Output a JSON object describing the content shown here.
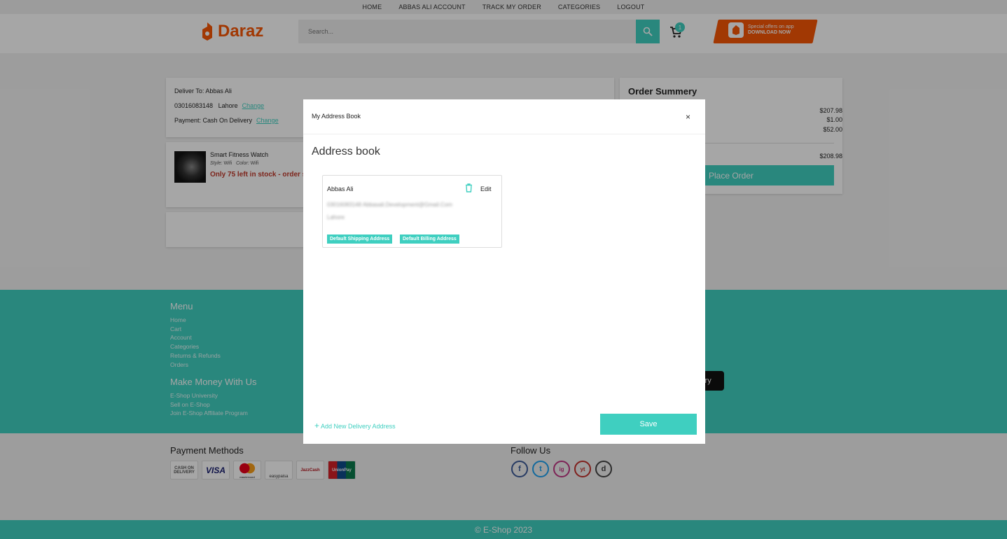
{
  "nav": {
    "items": [
      "HOME",
      "ABBAS ALI ACCOUNT",
      "TRACK MY ORDER",
      "CATEGORIES",
      "LOGOUT"
    ]
  },
  "header": {
    "logo_text": "Daraz",
    "search_placeholder": "Search...",
    "cart_count": "1",
    "promo_line1": "Special offers on app",
    "promo_line2": "DOWNLOAD NOW"
  },
  "delivery": {
    "deliver_to": "Deliver To: Abbas Ali",
    "phone": "03016083148",
    "city": "Lahore",
    "change1": "Change",
    "payment": "Payment: Cash On Delivery",
    "change2": "Change"
  },
  "item": {
    "title": "Smart Fitness Watch",
    "style_label": "Style:",
    "style_value": "Wifi",
    "color_label": "Color:",
    "color_value": "Wifi",
    "stock": "Only 75 left in stock - order s"
  },
  "summary": {
    "title": "Order Summery",
    "line1": "$207.98",
    "line2": "$1.00",
    "line3": "$52.00",
    "total": "$208.98",
    "button": "Place Order"
  },
  "footer": {
    "menu_title": "Menu",
    "menu_links": [
      "Home",
      "Cart",
      "Account",
      "Categories",
      "Returns & Refunds",
      "Orders"
    ],
    "money_title": "Make Money With Us",
    "money_links": [
      "E-Shop University",
      "Sell on E-Shop",
      "Join E-Shop Affiliate Program"
    ],
    "app_badge": "lery",
    "payment_title": "Payment Methods",
    "payment_methods": [
      "CASH ON DELIVERY",
      "VISA",
      "mastercard",
      "easypaisa",
      "JazzCash",
      "UnionPay"
    ],
    "follow_title": "Follow Us",
    "social": [
      "f",
      "t",
      "ig",
      "yt",
      "d"
    ],
    "copyright": "© E-Shop 2023"
  },
  "modal": {
    "title": "My Address Book",
    "close": "×",
    "heading": "Address book",
    "address": {
      "name": "Abbas Ali",
      "edit": "Edit",
      "phone_email": "03016083148    Abbasali.Development@Gmail.Com",
      "city": "Lahore",
      "tag1": "Default Shipping Address",
      "tag2": "Default Billing Address"
    },
    "add_new": "Add New Delivery Address",
    "save": "Save"
  },
  "colors": {
    "accent": "#3fcfc0",
    "brand": "#f85606",
    "stock": "#c0392b"
  }
}
